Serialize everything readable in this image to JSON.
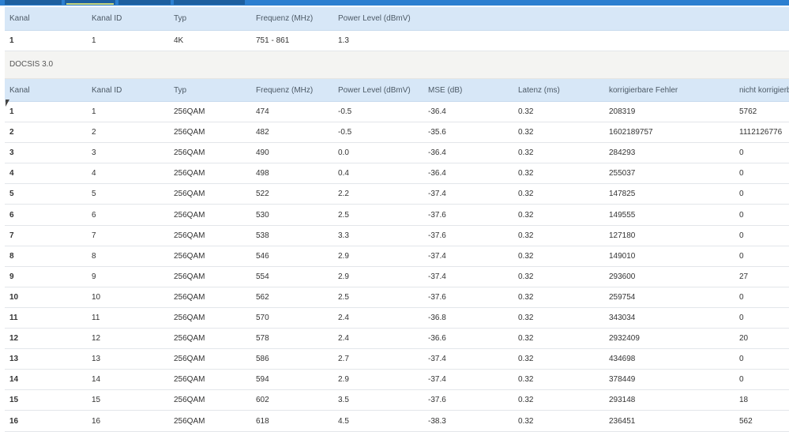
{
  "ofdm": {
    "headers": [
      "Kanal",
      "Kanal ID",
      "Typ",
      "Frequenz (MHz)",
      "Power Level (dBmV)"
    ],
    "rows": [
      [
        "1",
        "1",
        "4K",
        "751 - 861",
        "1.3"
      ]
    ]
  },
  "docsis30": {
    "title": "DOCSIS 3.0",
    "headers": [
      "Kanal",
      "Kanal ID",
      "Typ",
      "Frequenz (MHz)",
      "Power Level (dBmV)",
      "MSE (dB)",
      "Latenz (ms)",
      "korrigierbare Fehler",
      "nicht korrigierbare Fehler"
    ],
    "rows": [
      [
        "1",
        "1",
        "256QAM",
        "474",
        "-0.5",
        "-36.4",
        "0.32",
        "208319",
        "5762"
      ],
      [
        "2",
        "2",
        "256QAM",
        "482",
        "-0.5",
        "-35.6",
        "0.32",
        "1602189757",
        "1112126776"
      ],
      [
        "3",
        "3",
        "256QAM",
        "490",
        "0.0",
        "-36.4",
        "0.32",
        "284293",
        "0"
      ],
      [
        "4",
        "4",
        "256QAM",
        "498",
        "0.4",
        "-36.4",
        "0.32",
        "255037",
        "0"
      ],
      [
        "5",
        "5",
        "256QAM",
        "522",
        "2.2",
        "-37.4",
        "0.32",
        "147825",
        "0"
      ],
      [
        "6",
        "6",
        "256QAM",
        "530",
        "2.5",
        "-37.6",
        "0.32",
        "149555",
        "0"
      ],
      [
        "7",
        "7",
        "256QAM",
        "538",
        "3.3",
        "-37.6",
        "0.32",
        "127180",
        "0"
      ],
      [
        "8",
        "8",
        "256QAM",
        "546",
        "2.9",
        "-37.4",
        "0.32",
        "149010",
        "0"
      ],
      [
        "9",
        "9",
        "256QAM",
        "554",
        "2.9",
        "-37.4",
        "0.32",
        "293600",
        "27"
      ],
      [
        "10",
        "10",
        "256QAM",
        "562",
        "2.5",
        "-37.6",
        "0.32",
        "259754",
        "0"
      ],
      [
        "11",
        "11",
        "256QAM",
        "570",
        "2.4",
        "-36.8",
        "0.32",
        "343034",
        "0"
      ],
      [
        "12",
        "12",
        "256QAM",
        "578",
        "2.4",
        "-36.6",
        "0.32",
        "2932409",
        "20"
      ],
      [
        "13",
        "13",
        "256QAM",
        "586",
        "2.7",
        "-37.4",
        "0.32",
        "434698",
        "0"
      ],
      [
        "14",
        "14",
        "256QAM",
        "594",
        "2.9",
        "-37.4",
        "0.32",
        "378449",
        "0"
      ],
      [
        "15",
        "15",
        "256QAM",
        "602",
        "3.5",
        "-37.6",
        "0.32",
        "293148",
        "18"
      ],
      [
        "16",
        "16",
        "256QAM",
        "618",
        "4.5",
        "-38.3",
        "0.32",
        "236451",
        "562"
      ]
    ]
  }
}
